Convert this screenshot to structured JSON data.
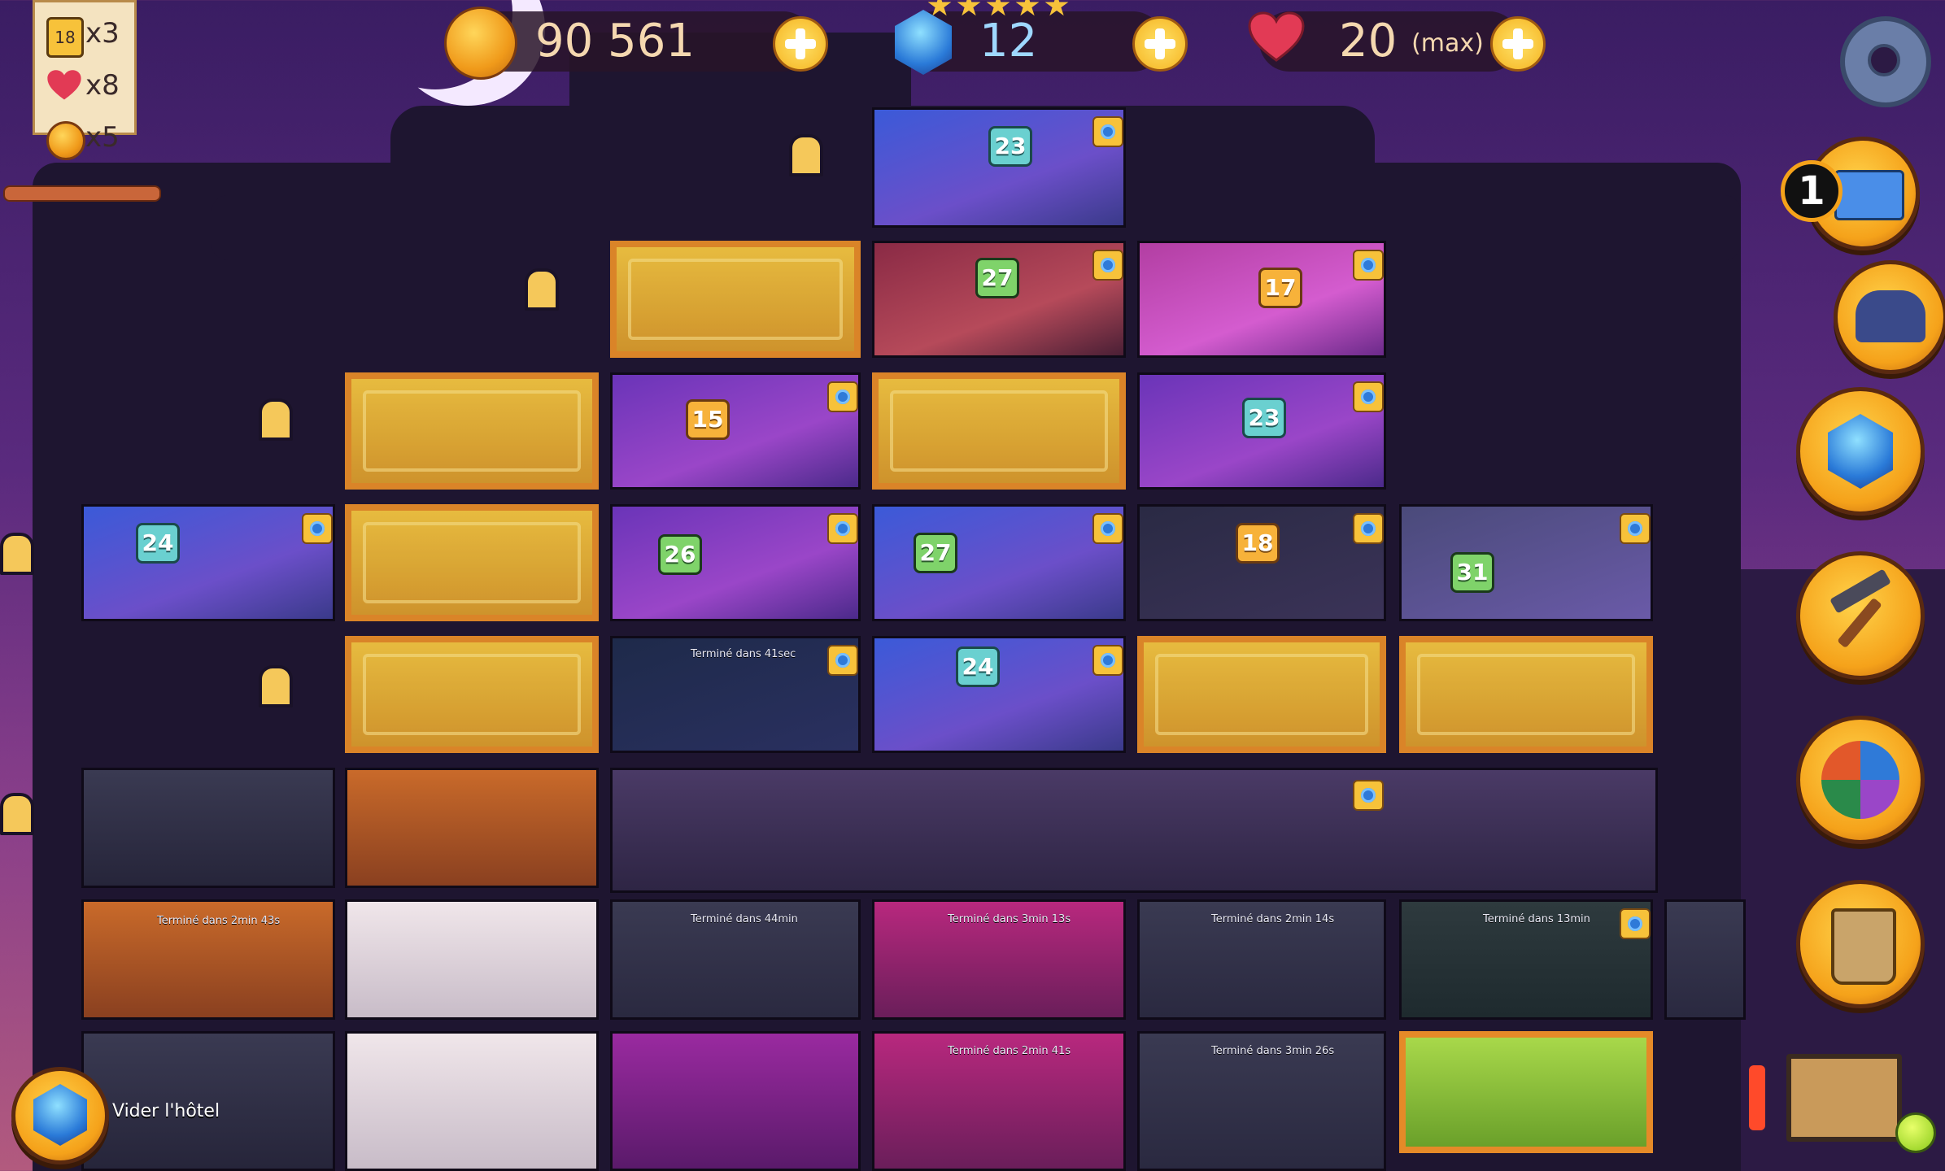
{
  "currency": {
    "coins": "90 561",
    "gems": "12",
    "hearts": "20",
    "hearts_max": "(max)"
  },
  "scroll": {
    "badge_level": "18",
    "rows": [
      {
        "label": "x3"
      },
      {
        "label": "x8"
      },
      {
        "label": "x5"
      }
    ]
  },
  "rooms": {
    "r1": "23",
    "r2": "27",
    "r3": "17",
    "r4": "15",
    "r5": "23",
    "r6": "24",
    "r7": "26",
    "r8": "27",
    "r9": "18",
    "r10": "31",
    "r11": "24"
  },
  "timers": {
    "t1": "Terminé dans 41sec",
    "t2": "Terminé dans 2min 43s",
    "t3": "Terminé dans 44min",
    "t4": "Terminé dans 3min 13s",
    "t5": "Terminé dans 2min 14s",
    "t6": "Terminé dans 13min",
    "t7": "Terminé dans 2min 41s",
    "t8": "Terminé dans 3min 26s"
  },
  "side": {
    "mail_count": "1"
  },
  "bottom": {
    "empty_hotel": "Vider l'hôtel"
  },
  "colors": {
    "accent": "#f5a21a",
    "gem": "#2f7ad8",
    "heart": "#e23a55",
    "locked_room": "#f2c440"
  }
}
